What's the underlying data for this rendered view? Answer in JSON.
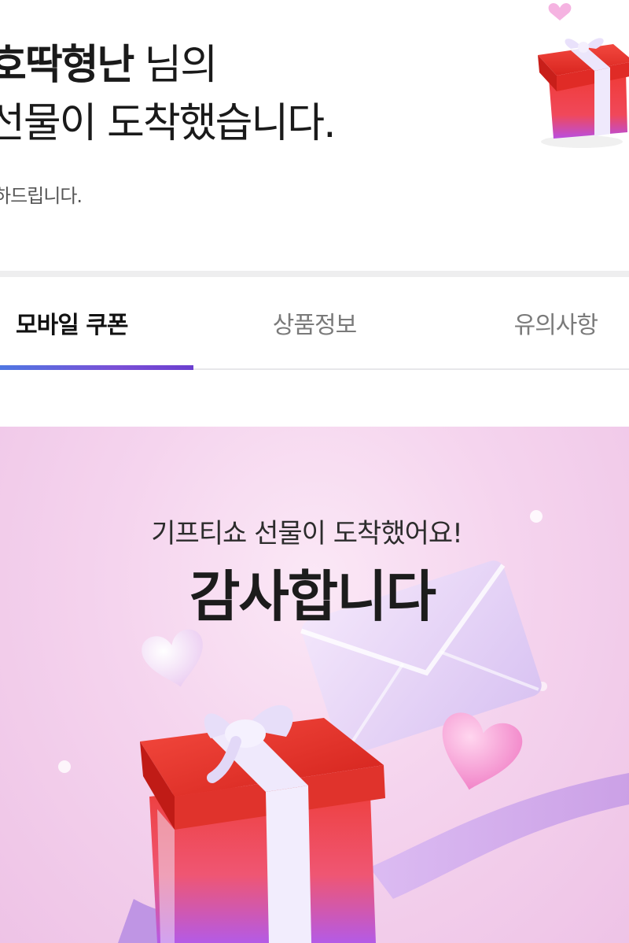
{
  "header": {
    "sender_name": "호딱형난",
    "title_suffix": "님의",
    "title_line2": "선물이 도착했습니다.",
    "subtitle": "하드립니다."
  },
  "tabs": [
    {
      "label": "모바일 쿠폰",
      "active": true
    },
    {
      "label": "상품정보",
      "active": false
    },
    {
      "label": "유의사항",
      "active": false
    }
  ],
  "card": {
    "subtitle": "기프티쇼 선물이 도착했어요!",
    "title": "감사합니다"
  },
  "colors": {
    "tab_indicator_start": "#4f77e2",
    "tab_indicator_end": "#6b3fcf",
    "card_background": "#f5d4ee",
    "gift_box": "#e8332f",
    "ribbon": "#ece6fb"
  }
}
